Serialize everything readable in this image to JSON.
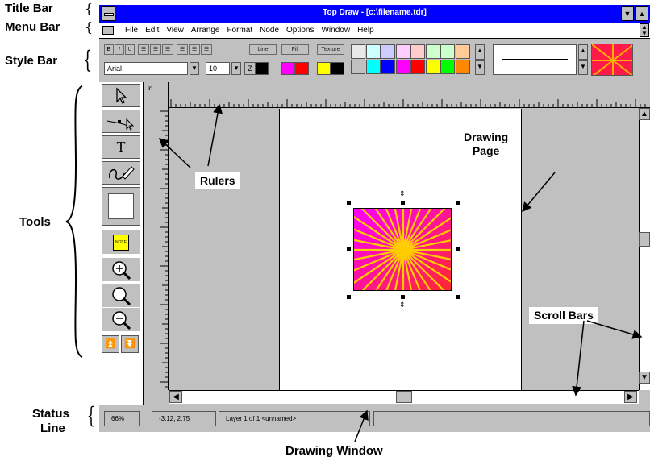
{
  "callouts": {
    "title_bar": "Title Bar",
    "menu_bar": "Menu Bar",
    "style_bar": "Style Bar",
    "tools": "Tools",
    "status_line_1": "Status",
    "status_line_2": "Line",
    "rulers": "Rulers",
    "drawing_page_1": "Drawing",
    "drawing_page_2": "Page",
    "scroll_bars": "Scroll Bars",
    "drawing_window": "Drawing Window"
  },
  "window": {
    "title": "Top Draw - [c:\\filename.tdr]"
  },
  "menu": {
    "items": [
      "File",
      "Edit",
      "View",
      "Arrange",
      "Format",
      "Node",
      "Options",
      "Window",
      "Help"
    ]
  },
  "style_bar": {
    "bold": "B",
    "italic": "I",
    "underline": "U",
    "line_button": "Line",
    "fill_button": "Fill",
    "texture_button": "Texture",
    "font_name": "Arial",
    "font_size": "10",
    "palette_top": [
      "#e8e8e8",
      "#ccffff",
      "#ccccff",
      "#ffccff",
      "#ffcccc",
      "#ccffcc",
      "#ccffcc",
      "#ffcc99"
    ],
    "palette_bottom": [
      "#c0c0c0",
      "#00ffff",
      "#0000ff",
      "#ff00ff",
      "#ff0000",
      "#ffff00",
      "#00ff00",
      "#ff8800"
    ]
  },
  "rulers": {
    "unit": "in"
  },
  "tools": {
    "note_label": "NOTE"
  },
  "status": {
    "zoom": "66%",
    "coordinates": "-3.12, 2.75",
    "layer": "Layer 1 of 1 <unnamed>"
  }
}
